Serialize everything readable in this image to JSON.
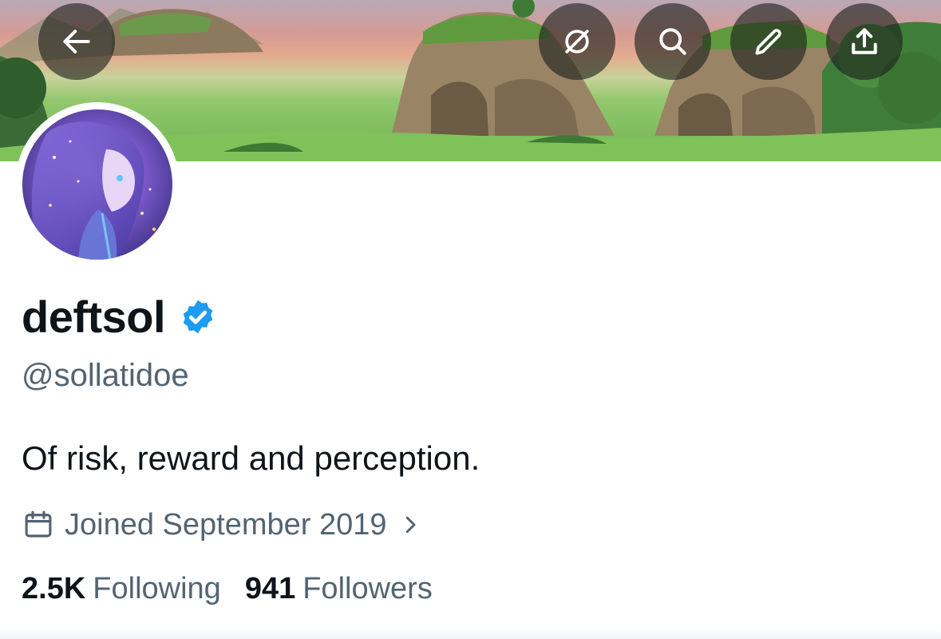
{
  "header": {
    "buttons": [
      {
        "name": "back-button",
        "icon": "arrow-left-icon"
      },
      {
        "name": "grok-button",
        "icon": "grok-icon"
      },
      {
        "name": "search-button",
        "icon": "search-icon"
      },
      {
        "name": "edit-button",
        "icon": "pencil-icon"
      },
      {
        "name": "share-button",
        "icon": "share-icon"
      }
    ]
  },
  "profile": {
    "display_name": "deftsol",
    "verified": true,
    "handle": "@sollatidoe",
    "bio": "Of risk, reward and perception.",
    "joined": "Joined September 2019",
    "following_count": "2.5K",
    "following_label": "Following",
    "followers_count": "941",
    "followers_label": "Followers"
  },
  "colors": {
    "text_primary": "#0f1419",
    "text_secondary": "#536471",
    "verified_blue": "#1d9bf0",
    "header_button_bg": "rgba(28,32,28,0.62)"
  }
}
